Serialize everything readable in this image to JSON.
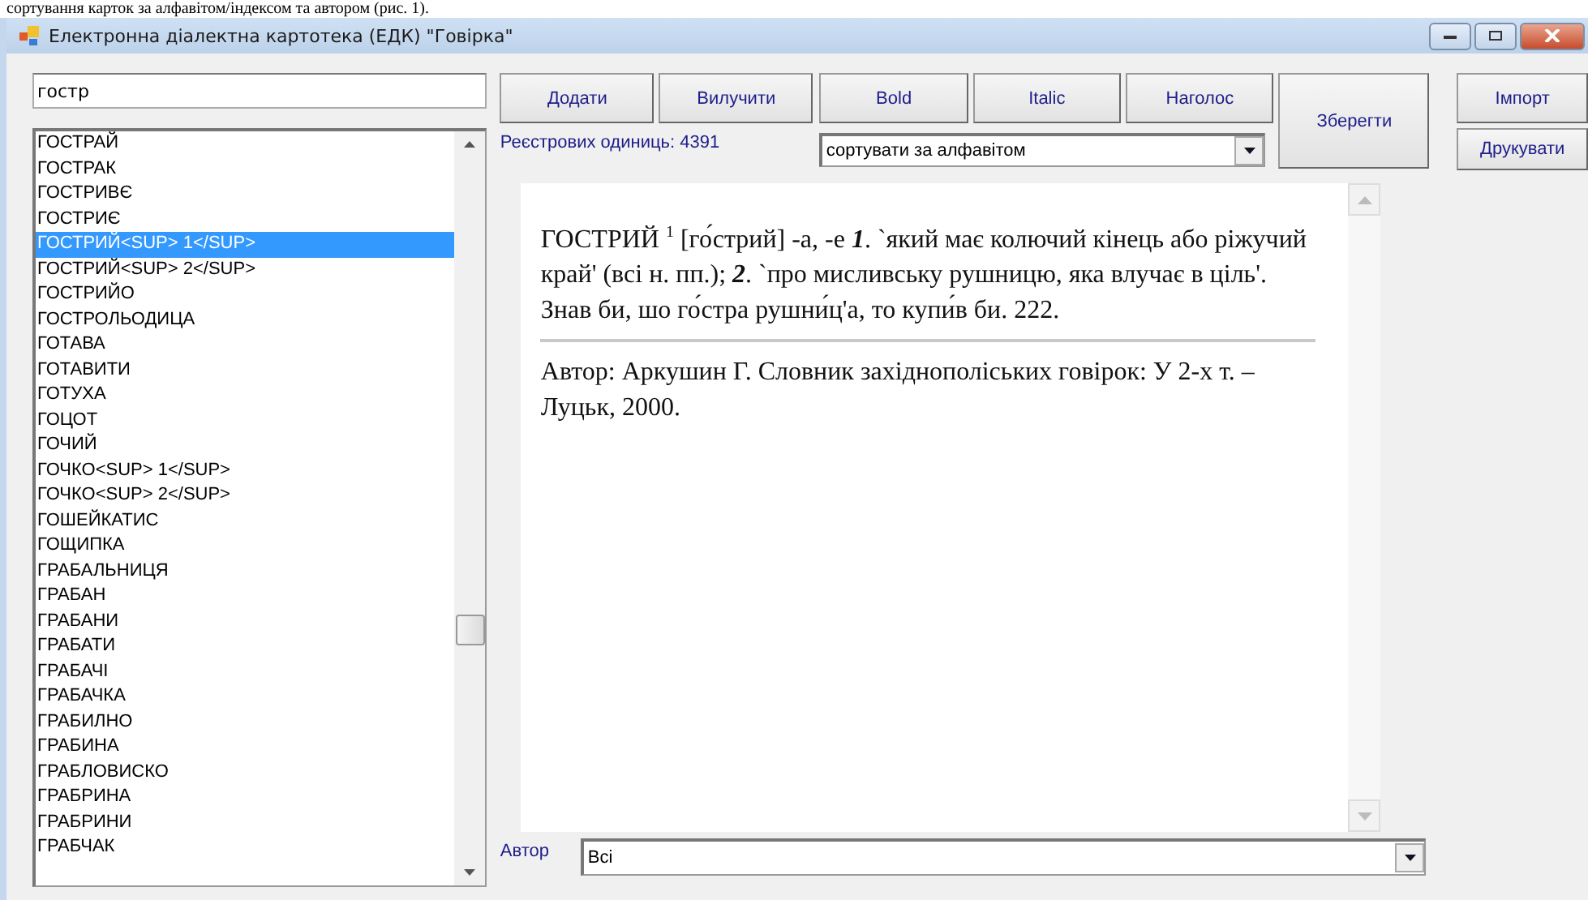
{
  "caption": "сортування карток за алфавітом/індексом та автором (рис. 1).",
  "window": {
    "title": "Електронна діалектна картотека (ЕДК) \"Говірка\""
  },
  "search": {
    "value": "гостр"
  },
  "words": [
    {
      "label": "ГОСТРАЙ",
      "selected": false
    },
    {
      "label": "ГОСТРАК",
      "selected": false
    },
    {
      "label": "ГОСТРИВЄ",
      "selected": false
    },
    {
      "label": "ГОСТРИЄ",
      "selected": false
    },
    {
      "label": "ГОСТРИЙ<SUP> 1</SUP>",
      "selected": true
    },
    {
      "label": "ГОСТРИЙ<SUP> 2</SUP>",
      "selected": false
    },
    {
      "label": "ГОСТРИЙО",
      "selected": false
    },
    {
      "label": "ГОСТРОЛЬОДИЦА",
      "selected": false
    },
    {
      "label": "ГОТАВА",
      "selected": false
    },
    {
      "label": "ГОТАВИТИ",
      "selected": false
    },
    {
      "label": "ГОТУХА",
      "selected": false
    },
    {
      "label": "ГОЦОТ",
      "selected": false
    },
    {
      "label": "ГОЧИЙ",
      "selected": false
    },
    {
      "label": "ГОЧКО<SUP> 1</SUP>",
      "selected": false
    },
    {
      "label": "ГОЧКО<SUP> 2</SUP>",
      "selected": false
    },
    {
      "label": "ГОШЕЙКАТИС",
      "selected": false
    },
    {
      "label": "ГОЩИПКА",
      "selected": false
    },
    {
      "label": "ГРАБАЛЬНИЦЯ",
      "selected": false
    },
    {
      "label": "ГРАБАН",
      "selected": false
    },
    {
      "label": "ГРАБАНИ",
      "selected": false
    },
    {
      "label": "ГРАБАТИ",
      "selected": false
    },
    {
      "label": "ГРАБАЧІ",
      "selected": false
    },
    {
      "label": "ГРАБАЧКА",
      "selected": false
    },
    {
      "label": "ГРАБИЛНО",
      "selected": false
    },
    {
      "label": "ГРАБИНА",
      "selected": false
    },
    {
      "label": "ГРАБЛОВИСКО",
      "selected": false
    },
    {
      "label": "ГРАБРИНА",
      "selected": false
    },
    {
      "label": "ГРАБРИНИ",
      "selected": false
    },
    {
      "label": "ГРАБЧАК",
      "selected": false
    }
  ],
  "edit_buttons": [
    "Додати",
    "Вилучити"
  ],
  "format_buttons": [
    "Bold",
    "Italic",
    "Наголос"
  ],
  "save_button": "Зберегти",
  "side_buttons": [
    "Імпорт",
    "Друкувати"
  ],
  "count_label": "Реєстрових одиниць: 4391",
  "sort": {
    "value": "сортувати за алфавітом"
  },
  "entry": {
    "definition": "ГОСТРИЙ $^{1}$ [го́стрий] -а, -е **1**. `який має колючий кінець або ріжучий край' (всі н. пп.); **2**. `про мисливську рушницю, яка влучає в ціль'. Знав би, шо го́стра рушни́ц'а, то купи́в би. 222.",
    "source": "Автор: Аркушин Г. Словник західнополіських говірок: У 2-х т. – Луцьк, 2000."
  },
  "author_filter": {
    "label": "Автор",
    "value": "Всі"
  }
}
